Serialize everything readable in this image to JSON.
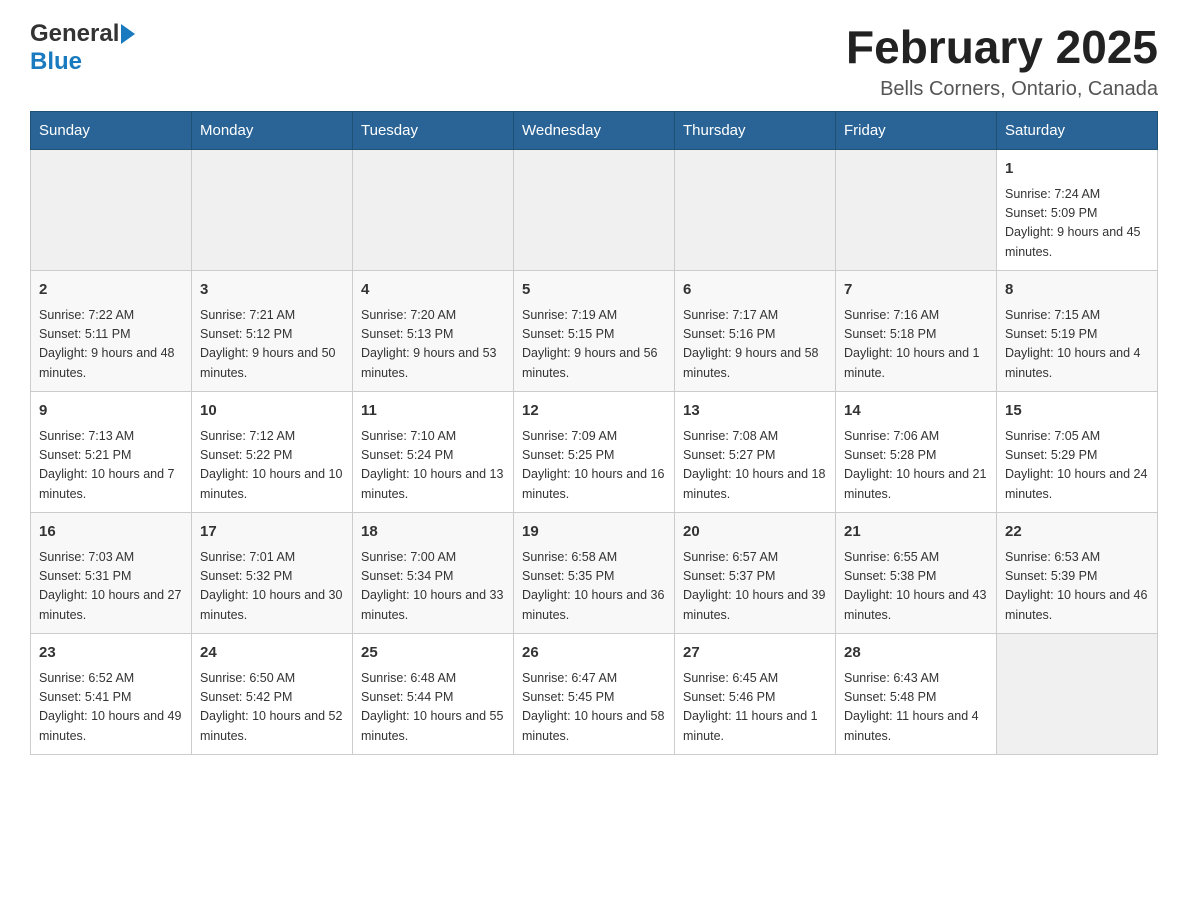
{
  "header": {
    "logo": {
      "general": "General",
      "blue": "Blue",
      "arrow_unicode": "▶"
    },
    "title": "February 2025",
    "location": "Bells Corners, Ontario, Canada"
  },
  "calendar": {
    "days_of_week": [
      "Sunday",
      "Monday",
      "Tuesday",
      "Wednesday",
      "Thursday",
      "Friday",
      "Saturday"
    ],
    "weeks": [
      [
        {
          "day": "",
          "info": ""
        },
        {
          "day": "",
          "info": ""
        },
        {
          "day": "",
          "info": ""
        },
        {
          "day": "",
          "info": ""
        },
        {
          "day": "",
          "info": ""
        },
        {
          "day": "",
          "info": ""
        },
        {
          "day": "1",
          "info": "Sunrise: 7:24 AM\nSunset: 5:09 PM\nDaylight: 9 hours and 45 minutes."
        }
      ],
      [
        {
          "day": "2",
          "info": "Sunrise: 7:22 AM\nSunset: 5:11 PM\nDaylight: 9 hours and 48 minutes."
        },
        {
          "day": "3",
          "info": "Sunrise: 7:21 AM\nSunset: 5:12 PM\nDaylight: 9 hours and 50 minutes."
        },
        {
          "day": "4",
          "info": "Sunrise: 7:20 AM\nSunset: 5:13 PM\nDaylight: 9 hours and 53 minutes."
        },
        {
          "day": "5",
          "info": "Sunrise: 7:19 AM\nSunset: 5:15 PM\nDaylight: 9 hours and 56 minutes."
        },
        {
          "day": "6",
          "info": "Sunrise: 7:17 AM\nSunset: 5:16 PM\nDaylight: 9 hours and 58 minutes."
        },
        {
          "day": "7",
          "info": "Sunrise: 7:16 AM\nSunset: 5:18 PM\nDaylight: 10 hours and 1 minute."
        },
        {
          "day": "8",
          "info": "Sunrise: 7:15 AM\nSunset: 5:19 PM\nDaylight: 10 hours and 4 minutes."
        }
      ],
      [
        {
          "day": "9",
          "info": "Sunrise: 7:13 AM\nSunset: 5:21 PM\nDaylight: 10 hours and 7 minutes."
        },
        {
          "day": "10",
          "info": "Sunrise: 7:12 AM\nSunset: 5:22 PM\nDaylight: 10 hours and 10 minutes."
        },
        {
          "day": "11",
          "info": "Sunrise: 7:10 AM\nSunset: 5:24 PM\nDaylight: 10 hours and 13 minutes."
        },
        {
          "day": "12",
          "info": "Sunrise: 7:09 AM\nSunset: 5:25 PM\nDaylight: 10 hours and 16 minutes."
        },
        {
          "day": "13",
          "info": "Sunrise: 7:08 AM\nSunset: 5:27 PM\nDaylight: 10 hours and 18 minutes."
        },
        {
          "day": "14",
          "info": "Sunrise: 7:06 AM\nSunset: 5:28 PM\nDaylight: 10 hours and 21 minutes."
        },
        {
          "day": "15",
          "info": "Sunrise: 7:05 AM\nSunset: 5:29 PM\nDaylight: 10 hours and 24 minutes."
        }
      ],
      [
        {
          "day": "16",
          "info": "Sunrise: 7:03 AM\nSunset: 5:31 PM\nDaylight: 10 hours and 27 minutes."
        },
        {
          "day": "17",
          "info": "Sunrise: 7:01 AM\nSunset: 5:32 PM\nDaylight: 10 hours and 30 minutes."
        },
        {
          "day": "18",
          "info": "Sunrise: 7:00 AM\nSunset: 5:34 PM\nDaylight: 10 hours and 33 minutes."
        },
        {
          "day": "19",
          "info": "Sunrise: 6:58 AM\nSunset: 5:35 PM\nDaylight: 10 hours and 36 minutes."
        },
        {
          "day": "20",
          "info": "Sunrise: 6:57 AM\nSunset: 5:37 PM\nDaylight: 10 hours and 39 minutes."
        },
        {
          "day": "21",
          "info": "Sunrise: 6:55 AM\nSunset: 5:38 PM\nDaylight: 10 hours and 43 minutes."
        },
        {
          "day": "22",
          "info": "Sunrise: 6:53 AM\nSunset: 5:39 PM\nDaylight: 10 hours and 46 minutes."
        }
      ],
      [
        {
          "day": "23",
          "info": "Sunrise: 6:52 AM\nSunset: 5:41 PM\nDaylight: 10 hours and 49 minutes."
        },
        {
          "day": "24",
          "info": "Sunrise: 6:50 AM\nSunset: 5:42 PM\nDaylight: 10 hours and 52 minutes."
        },
        {
          "day": "25",
          "info": "Sunrise: 6:48 AM\nSunset: 5:44 PM\nDaylight: 10 hours and 55 minutes."
        },
        {
          "day": "26",
          "info": "Sunrise: 6:47 AM\nSunset: 5:45 PM\nDaylight: 10 hours and 58 minutes."
        },
        {
          "day": "27",
          "info": "Sunrise: 6:45 AM\nSunset: 5:46 PM\nDaylight: 11 hours and 1 minute."
        },
        {
          "day": "28",
          "info": "Sunrise: 6:43 AM\nSunset: 5:48 PM\nDaylight: 11 hours and 4 minutes."
        },
        {
          "day": "",
          "info": ""
        }
      ]
    ]
  }
}
